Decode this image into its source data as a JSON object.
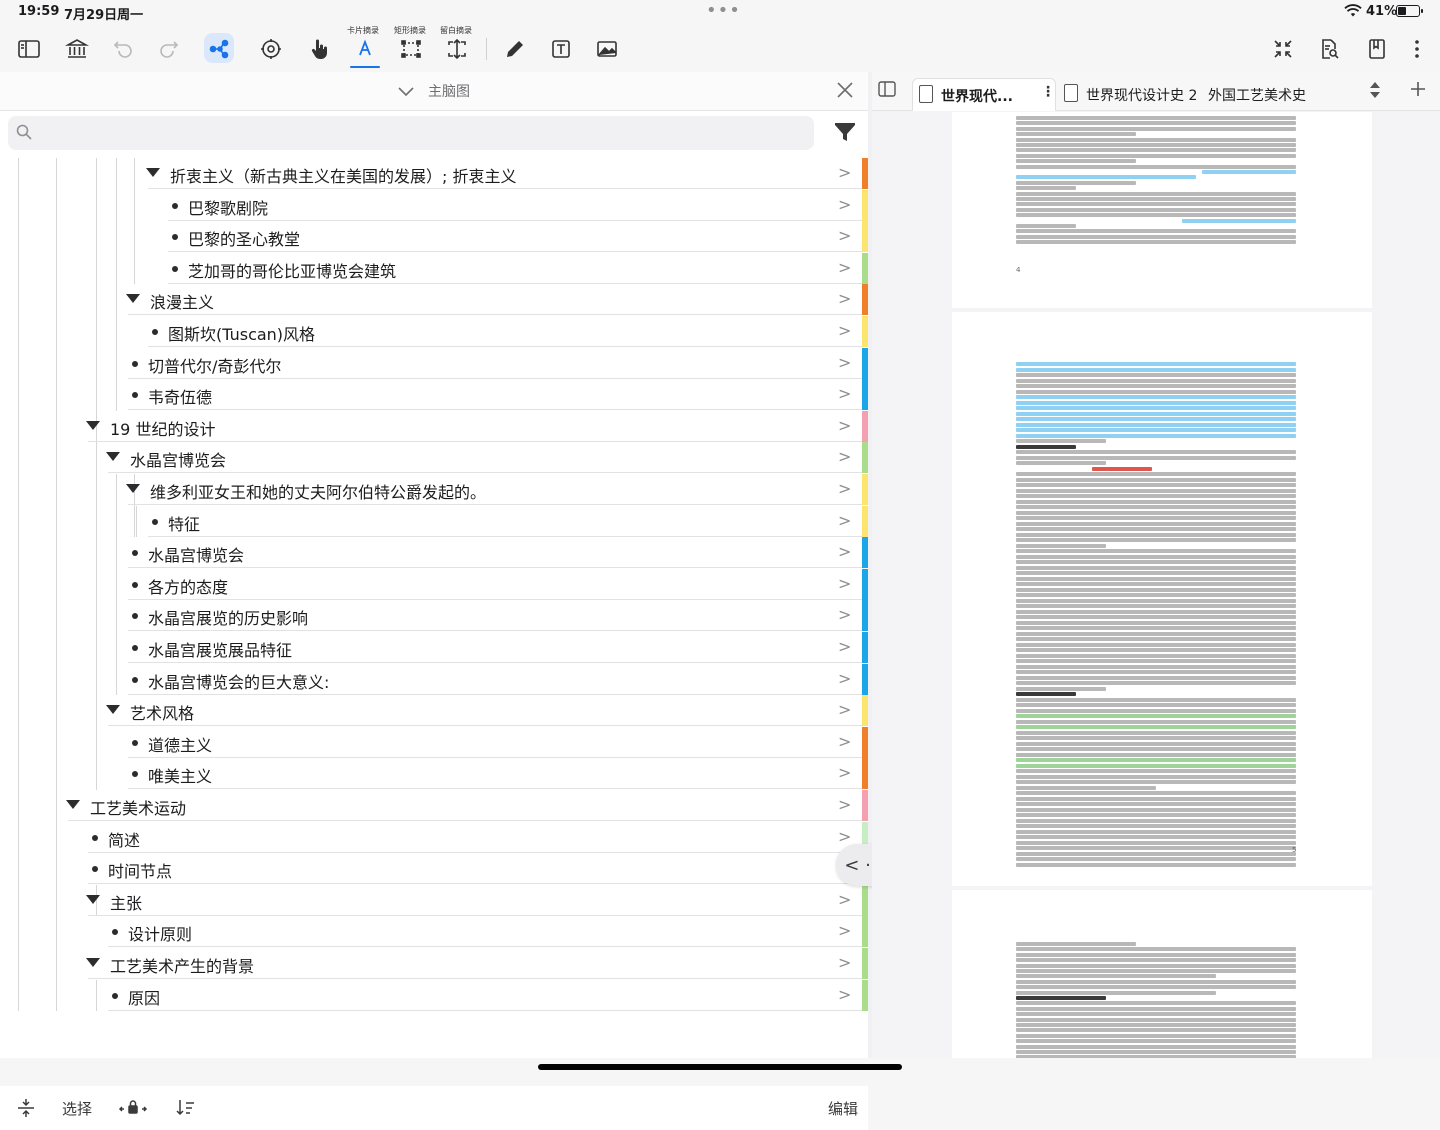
{
  "status": {
    "time": "19:59",
    "date": "7月29日周一",
    "battery": "41%",
    "battery_level": 0.41
  },
  "toolbar": {
    "card_excerpt": "卡片摘录",
    "rect_excerpt": "矩形摘录",
    "blank_excerpt": "留白摘录"
  },
  "mindmap": {
    "title": "主脑图",
    "search_placeholder": ""
  },
  "outline": [
    {
      "text": "折衷主义（新古典主义在美国的发展）; 折衷主义",
      "level": 3,
      "kind": "toggle",
      "color": "#f07f2c"
    },
    {
      "text": "巴黎歌剧院",
      "level": 4,
      "kind": "bullet",
      "color": "#fbe56e"
    },
    {
      "text": "巴黎的圣心教堂",
      "level": 4,
      "kind": "bullet",
      "color": "#fbe56e"
    },
    {
      "text": "芝加哥的哥伦比亚博览会建筑",
      "level": 4,
      "kind": "bullet",
      "color": "#a9dc8b"
    },
    {
      "text": "浪漫主义",
      "level": 2,
      "kind": "toggle",
      "color": "#f07f2c"
    },
    {
      "text": "图斯坎(Tuscan)风格",
      "level": 3,
      "kind": "bullet",
      "color": "#fbe56e"
    },
    {
      "text": "切普代尔/奇彭代尔",
      "level": 2,
      "kind": "bullet",
      "color": "#1aa6e8"
    },
    {
      "text": "韦奇伍德",
      "level": 2,
      "kind": "bullet",
      "color": "#1aa6e8"
    },
    {
      "text": "19 世纪的设计",
      "level": 0,
      "kind": "toggle",
      "color": "#f4a0b0"
    },
    {
      "text": "水晶宫博览会",
      "level": 1,
      "kind": "toggle",
      "color": "#a9dc8b"
    },
    {
      "text": "维多利亚女王和她的丈夫阿尔伯特公爵发起的。",
      "level": 2,
      "kind": "toggle",
      "color": "#fbe56e"
    },
    {
      "text": "特征",
      "level": 3,
      "kind": "bullet",
      "color": "#fbe56e"
    },
    {
      "text": "水晶宫博览会",
      "level": 2,
      "kind": "bullet",
      "color": "#1aa6e8"
    },
    {
      "text": "各方的态度",
      "level": 2,
      "kind": "bullet",
      "color": "#1aa6e8"
    },
    {
      "text": "水晶宫展览的历史影响",
      "level": 2,
      "kind": "bullet",
      "color": "#1aa6e8"
    },
    {
      "text": "水晶宫展览展品特征",
      "level": 2,
      "kind": "bullet",
      "color": "#1aa6e8"
    },
    {
      "text": "水晶宫博览会的巨大意义:",
      "level": 2,
      "kind": "bullet",
      "color": "#1aa6e8"
    },
    {
      "text": "艺术风格",
      "level": 1,
      "kind": "toggle",
      "color": "#fbe56e"
    },
    {
      "text": "道德主义",
      "level": 2,
      "kind": "bullet",
      "color": "#f07f2c"
    },
    {
      "text": "唯美主义",
      "level": 2,
      "kind": "bullet",
      "color": "#f07f2c"
    },
    {
      "text": "工艺美术运动",
      "level": -1,
      "kind": "toggle",
      "color": "#f4a0b0"
    },
    {
      "text": "简述",
      "level": 0,
      "kind": "bullet",
      "color": "#c8ecc4"
    },
    {
      "text": "时间节点",
      "level": 0,
      "kind": "bullet",
      "color": "#c8ecc4"
    },
    {
      "text": "主张",
      "level": 0,
      "kind": "toggle",
      "color": "#a9dc8b"
    },
    {
      "text": "设计原则",
      "level": 1,
      "kind": "bullet",
      "color": "#a9dc8b"
    },
    {
      "text": "工艺美术产生的背景",
      "level": 0,
      "kind": "toggle",
      "color": "#a9dc8b"
    },
    {
      "text": "原因",
      "level": 1,
      "kind": "bullet",
      "color": "#a9dc8b"
    }
  ],
  "outline_arrow": ">",
  "bottombar": {
    "select": "选择",
    "edit": "编辑"
  },
  "nav_pill": "< · >",
  "tabs": [
    {
      "label": "世界现代...",
      "active": true
    },
    {
      "label": "世界现代设计史 2",
      "active": false
    },
    {
      "label": "外国工艺美术史",
      "active": false
    }
  ],
  "pages": {
    "num_a": "4",
    "num_b": "5"
  },
  "colors": {
    "accent": "#1a73e8"
  }
}
